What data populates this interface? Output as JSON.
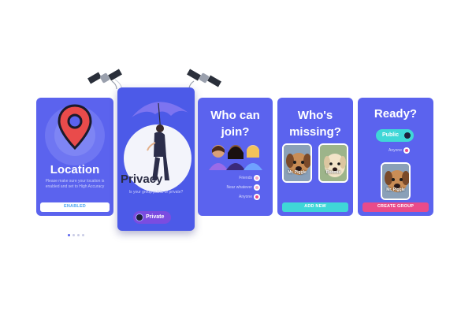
{
  "colors": {
    "card_blue": "#5b63ee",
    "card_blue_alt": "#4c5ae8",
    "accent_teal": "#3fd7d7",
    "accent_pink": "#e94b8a",
    "button_white": "#ffffff"
  },
  "location_card": {
    "title": "Location",
    "description": "Please make sure your location is enabled and set to High Accuracy",
    "button_label": "ENABLED",
    "icon": "map-pin-icon"
  },
  "privacy_card": {
    "title": "Privacy",
    "question": "Is your group public or private?",
    "toggle_label": "Private",
    "illustration": "woman-umbrella-illustration"
  },
  "who_can_join_card": {
    "title": "Who can join?",
    "options": [
      {
        "label": "Friends",
        "selected": false
      },
      {
        "label": "Near whatever",
        "selected": false
      },
      {
        "label": "Anyone",
        "selected": true
      }
    ]
  },
  "whos_missing_card": {
    "title": "Who's missing?",
    "pets": [
      {
        "name": "Mr. Piggle"
      },
      {
        "name": "Boomie"
      }
    ],
    "button_label": "ADD NEW"
  },
  "ready_card": {
    "title": "Ready?",
    "toggle_label": "Public",
    "option_label": "Anyone",
    "pet_name": "Mr. Piggle",
    "button_label": "CREATE GROUP"
  },
  "pagination": {
    "total": 4,
    "active": 0
  }
}
